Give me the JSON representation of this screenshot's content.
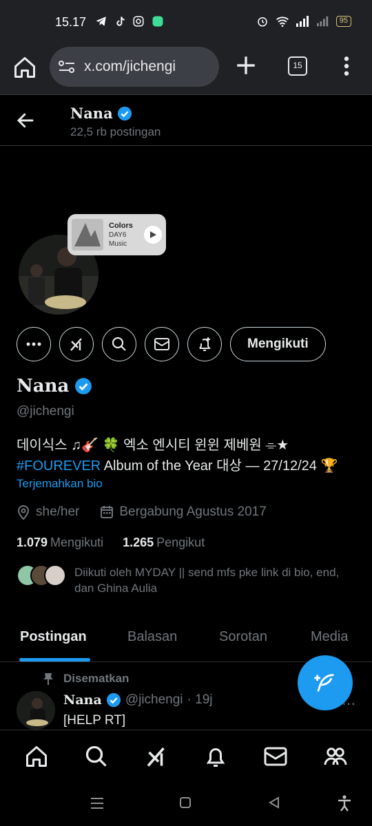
{
  "status_bar": {
    "time": "15.17",
    "battery": "95"
  },
  "browser": {
    "url": "x.com/jichengi",
    "tab_count": "15"
  },
  "header": {
    "name": "Nana",
    "post_count": "22,5 rb postingan"
  },
  "music": {
    "title": "Colors",
    "artist": "DAY6",
    "service": "Music"
  },
  "profile": {
    "name": "Nana",
    "handle": "@jichengi",
    "bio_line1": "데이식스 ♫🎸 🍀 엑소 엔시티 윈윈 제베원 ⌯★",
    "bio_hashtag": "#FOUREVER",
    "bio_line2_rest": " Album of the Year 대상 — 27/12/24 🏆",
    "translate_label": "Terjemahkan bio",
    "pronouns": "she/her",
    "joined": "Bergabung Agustus 2017",
    "following_count": "1.079",
    "following_label": "Mengikuti",
    "followers_count": "1.265",
    "followers_label": "Pengikut",
    "followed_by": "Diikuti oleh MYDAY || send mfs pke link di bio, end, dan Ghina Aulia"
  },
  "actions": {
    "follow_label": "Mengikuti"
  },
  "tabs": [
    {
      "label": "Postingan"
    },
    {
      "label": "Balasan"
    },
    {
      "label": "Sorotan"
    },
    {
      "label": "Media"
    }
  ],
  "pinned_post": {
    "pinned_label": "Disematkan",
    "name": "Nana",
    "handle": "@jichengi",
    "time": "· 19j",
    "text": "[HELP RT]"
  },
  "colors": {
    "accent": "#1d9bf0",
    "background": "#000000",
    "muted": "#71767b"
  }
}
